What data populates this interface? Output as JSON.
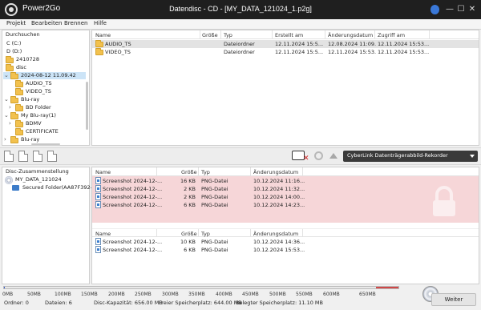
{
  "titlebar": {
    "app_name": "Power2Go",
    "window_title": "Datendisc - CD - [MY_DATA_121024_1.p2g]"
  },
  "menu": [
    "Projekt",
    "Bearbeiten",
    "Brennen",
    "Hilfe"
  ],
  "browse": {
    "label": "Durchsuchen",
    "tree": [
      {
        "label": "C (C:)"
      },
      {
        "label": "D (D:)"
      },
      {
        "label": "2410728"
      },
      {
        "label": "disc"
      },
      {
        "label": "2024-08-12 11.09.42"
      },
      {
        "label": "AUDIO_TS"
      },
      {
        "label": "VIDEO_TS"
      },
      {
        "label": "Blu-ray"
      },
      {
        "label": "BD Folder"
      },
      {
        "label": "My Blu-ray(1)"
      },
      {
        "label": "BDMV"
      },
      {
        "label": "CERTIFICATE"
      },
      {
        "label": "Blu-ray"
      }
    ]
  },
  "top_list": {
    "columns": [
      "Name",
      "Größe",
      "Typ",
      "Erstellt am",
      "Änderungsdatum",
      "Zugriff am"
    ],
    "rows": [
      {
        "name": "AUDIO_TS",
        "size": "",
        "type": "Dateiordner",
        "created": "12.11.2024 15:5...",
        "modified": "12.08.2024 11:09...",
        "accessed": "12.11.2024 15:53..."
      },
      {
        "name": "VIDEO_TS",
        "size": "",
        "type": "Dateiordner",
        "created": "12.11.2024 15:5...",
        "modified": "12.11.2024 15:53...",
        "accessed": "12.11.2024 15:53..."
      }
    ]
  },
  "recorder": {
    "selected": "CyberLink Datenträgerabbild-Rekorder"
  },
  "composition": {
    "label": "Disc-Zusammenstellung",
    "tree": [
      {
        "label": "MY_DATA_121024"
      },
      {
        "label": "Secured Folder(AA87F392-3"
      }
    ]
  },
  "secured_list": {
    "columns": [
      "Name",
      "Größe",
      "Typ",
      "Änderungsdatum"
    ],
    "rows": [
      {
        "name": "Screenshot 2024-12-...",
        "size": "16 KB",
        "type": "PNG-Datei",
        "modified": "10.12.2024 11:16..."
      },
      {
        "name": "Screenshot 2024-12-...",
        "size": "2 KB",
        "type": "PNG-Datei",
        "modified": "10.12.2024 11:32..."
      },
      {
        "name": "Screenshot 2024-12-...",
        "size": "2 KB",
        "type": "PNG-Datei",
        "modified": "10.12.2024 14:00..."
      },
      {
        "name": "Screenshot 2024-12-...",
        "size": "6 KB",
        "type": "PNG-Datei",
        "modified": "10.12.2024 14:23..."
      }
    ]
  },
  "other_list": {
    "columns": [
      "Name",
      "Größe",
      "Typ",
      "Änderungsdatum"
    ],
    "rows": [
      {
        "name": "Screenshot 2024-12-...",
        "size": "10 KB",
        "type": "PNG-Datei",
        "modified": "10.12.2024 14:36..."
      },
      {
        "name": "Screenshot 2024-12-...",
        "size": "6 KB",
        "type": "PNG-Datei",
        "modified": "10.12.2024 15:53..."
      }
    ]
  },
  "scale": {
    "ticks": [
      "0MB",
      "50MB",
      "100MB",
      "150MB",
      "200MB",
      "250MB",
      "300MB",
      "350MB",
      "400MB",
      "450MB",
      "500MB",
      "550MB",
      "600MB",
      "650MB"
    ],
    "used_fraction": 0.0006
  },
  "status": {
    "folders": "Ordner:  0",
    "files": "Dateien:  6",
    "capacity": "Disc-Kapazität:  656.00 MB",
    "free": "Freier Speicherplatz:  644.00 MB",
    "used": "Belegter Speicherplatz:  11.10 MB"
  },
  "actions": {
    "next_label": "Weiter"
  },
  "colors": {
    "secured_bg": "#f6d6d8",
    "selected_row": "#cce4f7",
    "accent": "#3a5fcd"
  }
}
